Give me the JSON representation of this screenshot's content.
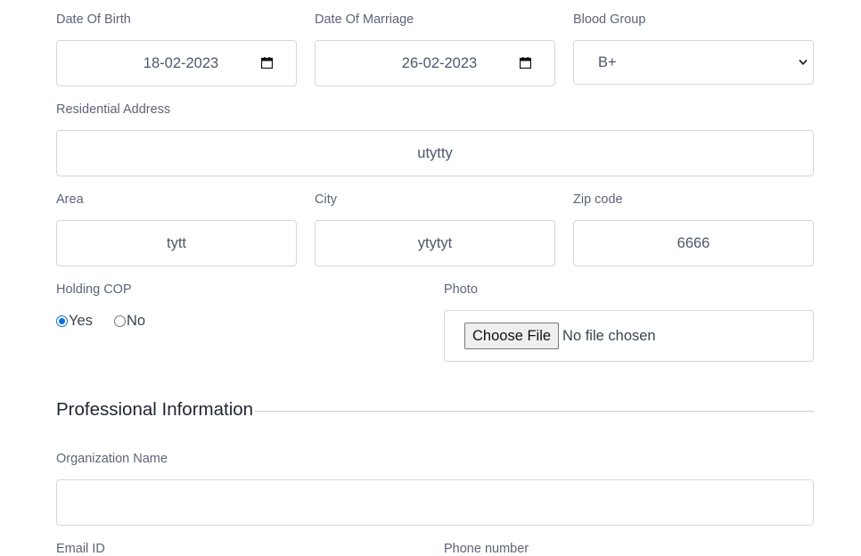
{
  "personal": {
    "dob": {
      "label": "Date Of Birth",
      "value": "18-02-2023"
    },
    "dom": {
      "label": "Date Of Marriage",
      "value": "26-02-2023"
    },
    "blood_group": {
      "label": "Blood Group",
      "value": "B+"
    },
    "address": {
      "label": "Residential Address",
      "value": "utytty"
    },
    "area": {
      "label": "Area",
      "value": "tytt"
    },
    "city": {
      "label": "City",
      "value": "ytytyt"
    },
    "zip": {
      "label": "Zip code",
      "value": "6666"
    },
    "holding_cop": {
      "label": "Holding COP",
      "options": [
        {
          "label": "Yes",
          "checked": true
        },
        {
          "label": "No",
          "checked": false
        }
      ]
    },
    "photo": {
      "label": "Photo",
      "button_label": "Choose File",
      "status": "No file chosen"
    }
  },
  "professional": {
    "section_title": "Professional Information",
    "org_name": {
      "label": "Organization Name",
      "value": ""
    },
    "email": {
      "label": "Email ID"
    },
    "phone": {
      "label": "Phone number"
    }
  },
  "colors": {
    "accent": "#0b6fd6",
    "border": "#d3d7de",
    "label": "#5d6478"
  }
}
